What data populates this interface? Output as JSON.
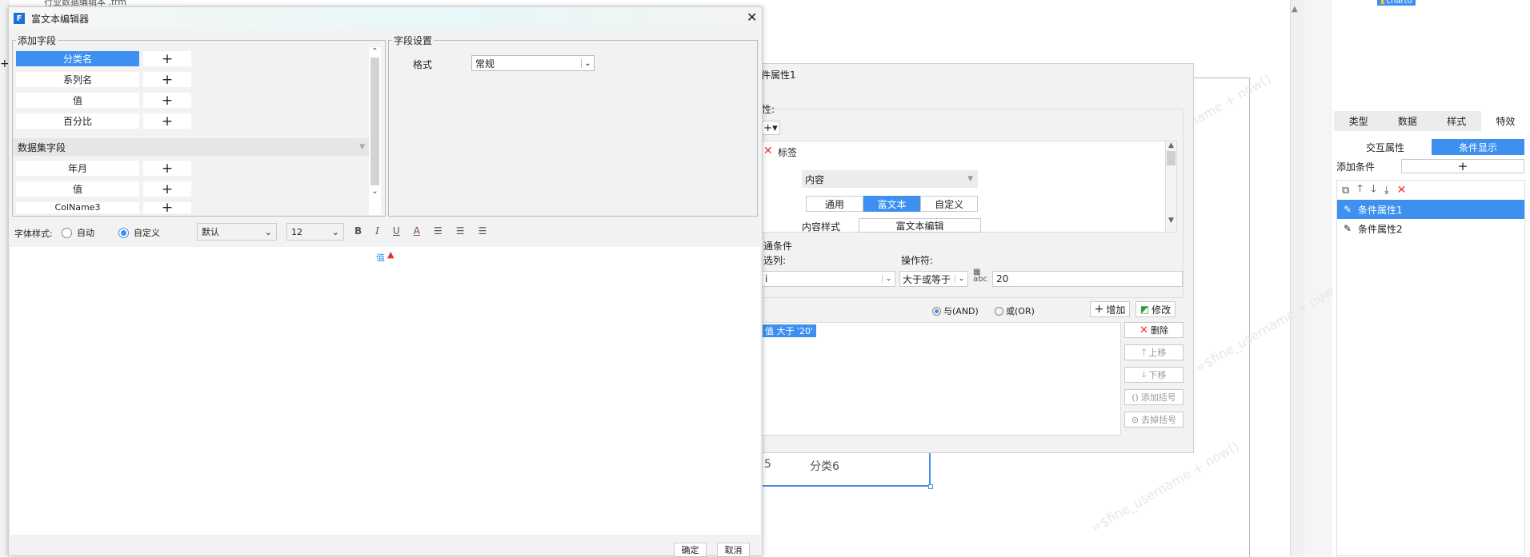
{
  "app": {
    "top_text": "行业数据编辑本 .frm",
    "chart_tag": "chart0"
  },
  "right_panel": {
    "tabs": [
      "类型",
      "数据",
      "样式",
      "特效"
    ],
    "active_tab": 3,
    "subtabs": [
      "交互属性",
      "条件显示"
    ],
    "add_condition_label": "添加条件",
    "conditions": [
      "条件属性1",
      "条件属性2"
    ]
  },
  "cond_dialog": {
    "title": "件属性1",
    "prop_label": "性:",
    "label_item": "标签",
    "content_select": "内容",
    "content_tabs": [
      "通用",
      "富文本",
      "自定义"
    ],
    "content_style_label": "内容样式",
    "rich_edit_button": "富文本编辑",
    "common_cond_label": "通条件",
    "col_label": "选列:",
    "col_value": "i",
    "operator_label": "操作符:",
    "operator_value": "大于或等于",
    "value_input": "20",
    "and_label": "与(AND)",
    "or_label": "或(OR)",
    "add_button": "增加",
    "modify_button": "修改",
    "cond_expr": "值 大于 '20'",
    "side_buttons": [
      "删除",
      "上移",
      "下移",
      "添加括号",
      "去掉括号"
    ]
  },
  "canvas": {
    "cat5": "5",
    "cat6": "分类6",
    "watermark": "=$fine_username + now()"
  },
  "editor": {
    "title": "富文本编辑器",
    "add_field_label": "添加字段",
    "fields": [
      "分类名",
      "系列名",
      "值",
      "百分比"
    ],
    "dataset_label": "数据集字段",
    "dataset_fields": [
      "年月",
      "值",
      "ColName3"
    ],
    "field_settings_label": "字段设置",
    "format_label": "格式",
    "format_value": "常规",
    "font_style_label": "字体样式:",
    "auto_label": "自动",
    "custom_label": "自定义",
    "font_family": "默认",
    "font_size": "12",
    "content_token": "值",
    "ok": "确定",
    "cancel": "取消"
  }
}
